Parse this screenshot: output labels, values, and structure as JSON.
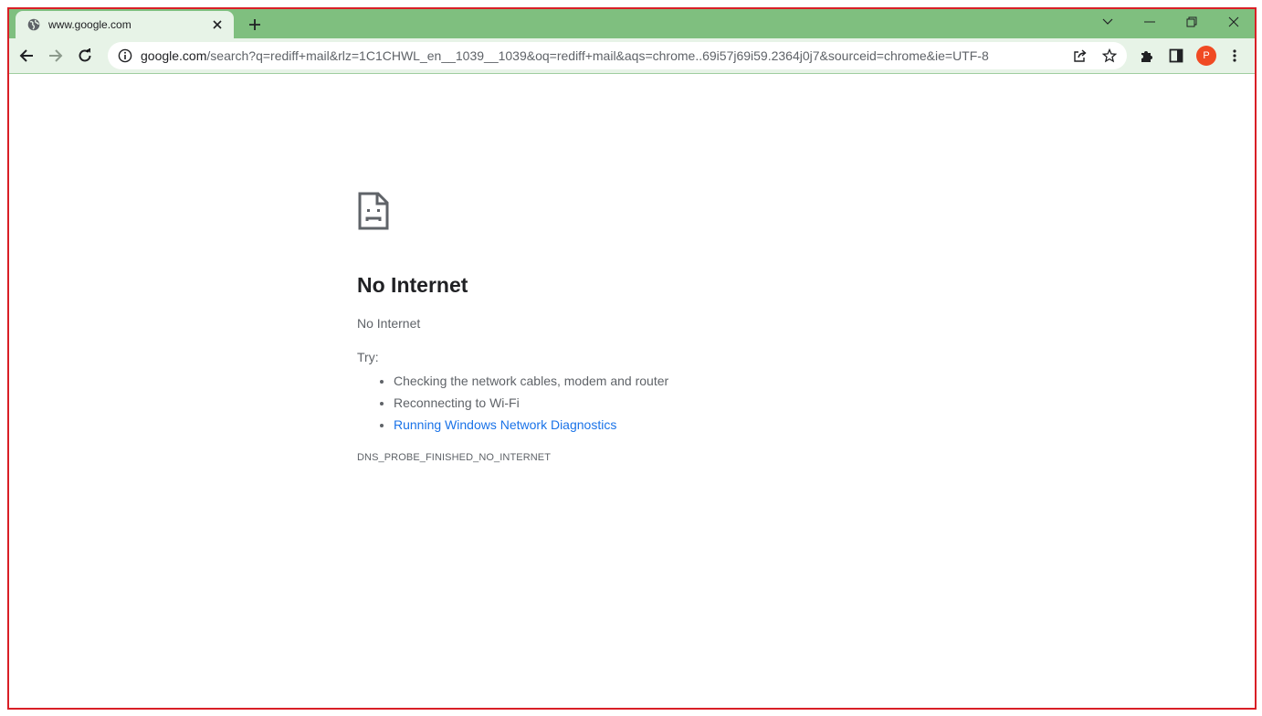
{
  "browser": {
    "tab": {
      "title": "www.google.com",
      "favicon": "globe-icon"
    },
    "omnibox": {
      "host": "google.com",
      "path": "/search?q=rediff+mail&rlz=1C1CHWL_en__1039__1039&oq=rediff+mail&aqs=chrome..69i57j69i59.2364j0j7&sourceid=chrome&ie=UTF-8"
    },
    "profile_initial": "P",
    "colors": {
      "frame": "#7fbf7f",
      "toolbar": "#e7f3e7",
      "avatar": "#f04a23",
      "link": "#1a73e8"
    }
  },
  "error_page": {
    "icon": "sad-file-icon",
    "heading": "No Internet",
    "subheading": "No Internet",
    "try_label": "Try:",
    "suggestions": [
      "Checking the network cables, modem and router",
      "Reconnecting to Wi-Fi",
      "Running Windows Network Diagnostics"
    ],
    "error_code": "DNS_PROBE_FINISHED_NO_INTERNET"
  }
}
